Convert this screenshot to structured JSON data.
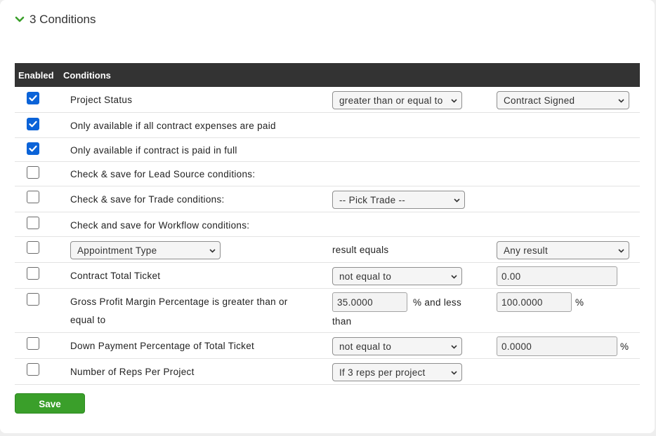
{
  "section": {
    "title": "3 Conditions"
  },
  "table": {
    "col_enabled": "Enabled",
    "col_conditions": "Conditions"
  },
  "rows": {
    "project_status": {
      "enabled": true,
      "label": "Project Status",
      "operator": "greater than or equal to",
      "value": "Contract Signed"
    },
    "expenses_paid": {
      "enabled": true,
      "label": "Only available if all contract expenses are paid"
    },
    "paid_in_full": {
      "enabled": true,
      "label": "Only available if contract is paid in full"
    },
    "lead_source": {
      "enabled": false,
      "label": "Check & save for Lead Source conditions:"
    },
    "trade": {
      "enabled": false,
      "label": "Check & save for Trade conditions:",
      "select": "-- Pick Trade --"
    },
    "workflow": {
      "enabled": false,
      "label": "Check and save for Workflow conditions:"
    },
    "appointment": {
      "enabled": false,
      "type": "Appointment Type",
      "text": "result equals",
      "result": "Any result"
    },
    "contract_total": {
      "enabled": false,
      "label": "Contract Total Ticket",
      "operator": "not equal to",
      "value": "0.00"
    },
    "gross_profit": {
      "enabled": false,
      "label_line1": "Gross Profit Margin Percentage is greater than or",
      "label_line2": "equal to",
      "min": "35.0000",
      "mid_line1": "% and less",
      "mid_line2": "than",
      "max": "100.0000",
      "unit": "%"
    },
    "down_payment": {
      "enabled": false,
      "label": "Down Payment Percentage of Total Ticket",
      "operator": "not equal to",
      "value": "0.0000",
      "unit": "%"
    },
    "reps": {
      "enabled": false,
      "label": "Number of Reps Per Project",
      "select": "If 3 reps per project"
    }
  },
  "save_label": "Save",
  "colors": {
    "header_bg": "#333333",
    "checkbox_on": "#0b63d8",
    "save_bg": "#3a9f2a",
    "chevron": "#3a9f2a"
  }
}
